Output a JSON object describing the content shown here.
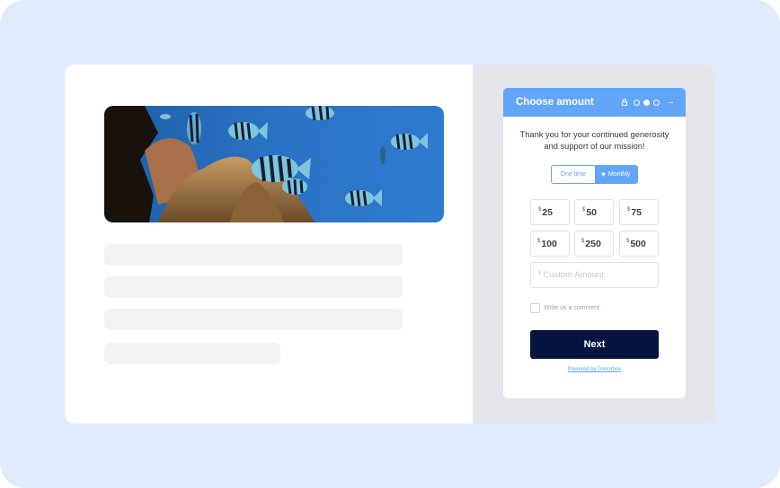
{
  "widget": {
    "header": {
      "title": "Choose amount",
      "icons": [
        "lock-icon",
        "step-dot-empty",
        "step-dot-filled",
        "step-dot-empty",
        "arrow-right-icon"
      ],
      "current_step": 2,
      "total_steps": 3,
      "color": "#62a5f9"
    },
    "thanks_text_line1": "Thank you for your continued generosity",
    "thanks_text_line2": "and support of our mission!",
    "frequency": {
      "options": [
        {
          "label": "One time",
          "selected": false
        },
        {
          "label": "Monthly",
          "selected": true,
          "icon": "heart-icon"
        }
      ]
    },
    "currency_symbol": "$",
    "amounts": [
      "25",
      "50",
      "75",
      "100",
      "250",
      "500"
    ],
    "custom_amount_placeholder": "Custom Amount",
    "comment_label": "Write us a comment",
    "comment_checked": false,
    "next_label": "Next",
    "next_color": "#06143f",
    "powered_by": "Powered by Donorbox"
  },
  "content": {
    "hero_image": "coral-reef-with-striped-fish",
    "skeleton_lines": 4
  }
}
